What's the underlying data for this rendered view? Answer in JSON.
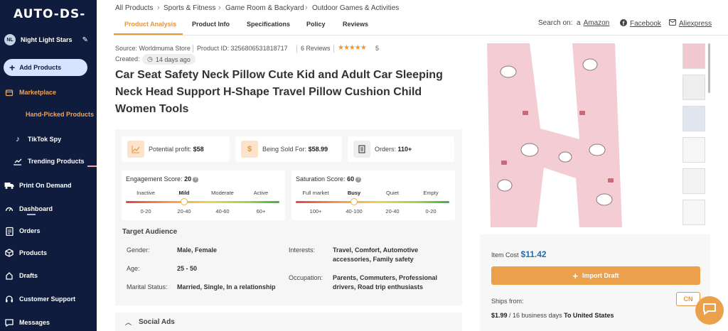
{
  "app": {
    "logo": "AUTO-DS-"
  },
  "user": {
    "initials": "NL",
    "name": "Night Light Stars"
  },
  "sidebar": {
    "add_label": "Add Products",
    "items": [
      {
        "label": "Marketplace",
        "icon": "store-icon"
      },
      {
        "label": "Hand-Picked Products",
        "icon": "none"
      },
      {
        "label": "TikTok Spy",
        "icon": "tiktok-icon"
      },
      {
        "label": "Trending Products",
        "icon": "trending-icon"
      },
      {
        "label": "Print On Demand",
        "icon": "truck-icon"
      },
      {
        "label": "Dashboard",
        "icon": "gauge-icon"
      },
      {
        "label": "Orders",
        "icon": "clipboard-icon"
      },
      {
        "label": "Products",
        "icon": "box-icon"
      },
      {
        "label": "Drafts",
        "icon": "drafts-icon"
      },
      {
        "label": "Customer Support",
        "icon": "headset-icon"
      },
      {
        "label": "Messages",
        "icon": "chat-icon"
      }
    ]
  },
  "breadcrumb": [
    "All Products",
    "Sports & Fitness",
    "Game Room & Backyard",
    "Outdoor Games & Activities"
  ],
  "tabs": [
    "Product Analysis",
    "Product Info",
    "Specifications",
    "Policy",
    "Reviews"
  ],
  "search_on": {
    "label": "Search on:",
    "sites": [
      "Amazon",
      "Facebook",
      "Aliexpress"
    ]
  },
  "product": {
    "source": "Source: Worldmuma Store",
    "product_id": "Product ID: 3256806531818717",
    "reviews": "6 Reviews",
    "rating": "5",
    "created_label": "Created:",
    "created_ago": "14 days ago",
    "title": "Car Seat Safety Neck Pillow Cute Kid and Adult Car Sleeping Neck Head Support H-Shape Travel Pillow Cushion Child Women Tools"
  },
  "stats": {
    "profit_label": "Potential profit:",
    "profit": "$58",
    "sold_label": "Being Sold For:",
    "sold": "$58.99",
    "orders_label": "Orders:",
    "orders": "110+"
  },
  "engagement": {
    "label": "Engagement Score:",
    "value": "20",
    "levels": [
      "Inactive",
      "Mild",
      "Moderate",
      "Active"
    ],
    "ranges": [
      "0-20",
      "20-40",
      "40-60",
      "60+"
    ],
    "selected": 1
  },
  "saturation": {
    "label": "Saturation Score:",
    "value": "60",
    "levels": [
      "Full market",
      "Busy",
      "Quiet",
      "Empty"
    ],
    "ranges": [
      "100+",
      "40-100",
      "20-40",
      "0-20"
    ],
    "selected": 1
  },
  "audience": {
    "title": "Target Audience",
    "gender_label": "Gender:",
    "gender": "Male, Female",
    "age_label": "Age:",
    "age": "25 - 50",
    "marital_label": "Marital Status:",
    "marital": "Married, Single, In a relationship",
    "interests_label": "Interests:",
    "interests_1": "Travel, Comfort, Automotive",
    "interests_2": "accessories, Family safety",
    "occupation_label": "Occupation:",
    "occupation_1": "Parents, Commuters, Professional",
    "occupation_2": "drivers, Road trip enthusiasts"
  },
  "social_ads": "Social Ads",
  "purchase": {
    "item_cost_label": "Item Cost",
    "item_cost": "$11.42",
    "import_label": "Import Draft",
    "ships_from_label": "Ships from:",
    "ships_from": "CN",
    "shipping_price": "$1.99",
    "shipping_days": "/ 16 business days",
    "shipping_to": "To United States"
  },
  "colors": {
    "sidebar": "#0f1c3d",
    "accent": "#e5953d",
    "price": "#1e6fb8"
  }
}
